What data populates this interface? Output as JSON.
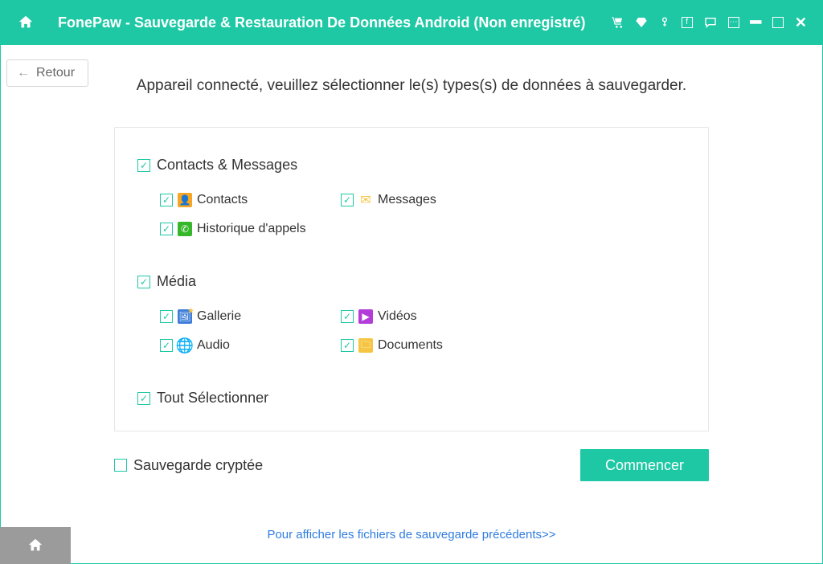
{
  "title": "FonePaw - Sauvegarde & Restauration De Données Android (Non enregistré)",
  "back_label": "Retour",
  "prompt": "Appareil connecté, veuillez sélectionner le(s) types(s) de données à sauvegarder.",
  "sections": {
    "contacts_messages": {
      "title": "Contacts & Messages",
      "items": {
        "contacts": "Contacts",
        "messages": "Messages",
        "calls": "Historique d'appels"
      }
    },
    "media": {
      "title": "Média",
      "items": {
        "gallery": "Gallerie",
        "videos": "Vidéos",
        "audio": "Audio",
        "documents": "Documents"
      }
    },
    "select_all": "Tout Sélectionner"
  },
  "encrypt_label": "Sauvegarde cryptée",
  "start_label": "Commencer",
  "prev_backups_link": "Pour afficher les fichiers de sauvegarde précédents>>"
}
